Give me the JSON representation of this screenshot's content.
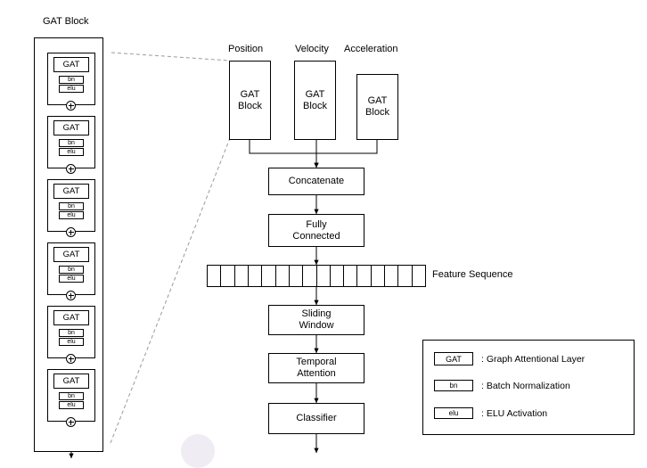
{
  "diagram": {
    "title": "GAT Block",
    "column_labels": {
      "position": "Position",
      "velocity": "Velocity",
      "acceleration": "Acceleration"
    },
    "gat_block_label_line1": "GAT",
    "gat_block_label_line2": "Block",
    "branches": [
      {
        "label_line1": "GAT",
        "label_line2": "Block"
      },
      {
        "label_line1": "GAT",
        "label_line2": "Block"
      },
      {
        "label_line1": "GAT",
        "label_line2": "Block"
      }
    ],
    "pipeline": [
      {
        "name": "concatenate",
        "line1": "Concatenate",
        "line2": ""
      },
      {
        "name": "fully-connected",
        "line1": "Fully",
        "line2": "Connected"
      },
      {
        "name": "sliding-window",
        "line1": "Sliding",
        "line2": "Window"
      },
      {
        "name": "temporal-attention",
        "line1": "Temporal",
        "line2": "Attention"
      },
      {
        "name": "classifier",
        "line1": "Classifier",
        "line2": ""
      }
    ],
    "feature_sequence_label": "Feature Sequence",
    "feature_sequence_cells": 16,
    "stack_units": [
      {
        "gat": "GAT",
        "bn": "bn",
        "elu": "elu"
      },
      {
        "gat": "GAT",
        "bn": "bn",
        "elu": "elu"
      },
      {
        "gat": "GAT",
        "bn": "bn",
        "elu": "elu"
      },
      {
        "gat": "GAT",
        "bn": "bn",
        "elu": "elu"
      },
      {
        "gat": "GAT",
        "bn": "bn",
        "elu": "elu"
      },
      {
        "gat": "GAT",
        "bn": "bn",
        "elu": "elu"
      }
    ],
    "legend": [
      {
        "chip": "GAT",
        "text": ": Graph Attentional Layer"
      },
      {
        "chip": "bn",
        "text": ": Batch Normalization"
      },
      {
        "chip": "elu",
        "text": ": ELU Activation"
      }
    ],
    "colors": {
      "stroke": "#000000",
      "dashed": "#9a9a9a",
      "background": "#ffffff"
    }
  }
}
